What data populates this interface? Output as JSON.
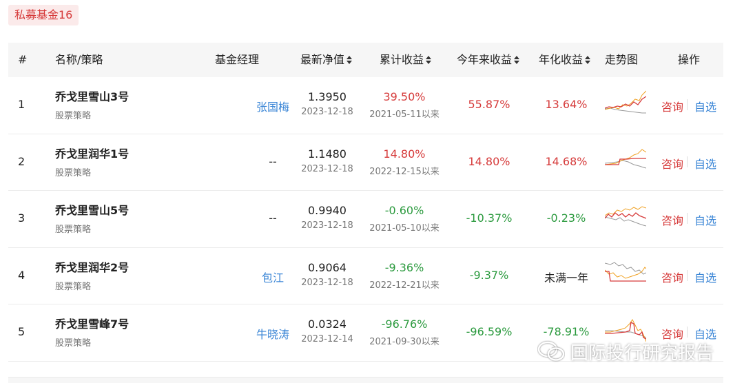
{
  "tag": "私募基金16",
  "headers": {
    "index": "#",
    "name": "名称/策略",
    "manager": "基金经理",
    "nav": "最新净值",
    "cumulative": "累计收益",
    "ytd": "今年来收益",
    "annual": "年化收益",
    "trend": "走势图",
    "ops": "操作"
  },
  "colors": {
    "red": "#d63b3b",
    "green": "#2b9a3e",
    "blue": "#3b86d6",
    "orange": "#f0a020",
    "gray": "#999999"
  },
  "rows": [
    {
      "index": "1",
      "name": "乔戈里雪山3号",
      "strategy": "股票策略",
      "manager": "张国梅",
      "nav": "1.3950",
      "nav_date": "2023-12-18",
      "cumulative": "39.50%",
      "since": "2021-05-11以来",
      "ytd": "55.87%",
      "annual": "13.64%",
      "consult": "咨询",
      "watch": "自选"
    },
    {
      "index": "2",
      "name": "乔戈里润华1号",
      "strategy": "股票策略",
      "manager": "--",
      "nav": "1.1480",
      "nav_date": "2023-12-18",
      "cumulative": "14.80%",
      "since": "2022-12-15以来",
      "ytd": "14.80%",
      "annual": "14.68%",
      "consult": "咨询",
      "watch": "自选"
    },
    {
      "index": "3",
      "name": "乔戈里雪山5号",
      "strategy": "股票策略",
      "manager": "--",
      "nav": "0.9940",
      "nav_date": "2023-12-18",
      "cumulative": "-0.60%",
      "since": "2021-05-10以来",
      "ytd": "-10.37%",
      "annual": "-0.23%",
      "consult": "咨询",
      "watch": "自选"
    },
    {
      "index": "4",
      "name": "乔戈里润华2号",
      "strategy": "股票策略",
      "manager": "包江",
      "nav": "0.9064",
      "nav_date": "2023-12-18",
      "cumulative": "-9.36%",
      "since": "2022-12-21以来",
      "ytd": "-9.37%",
      "annual": "未满一年",
      "consult": "咨询",
      "watch": "自选"
    },
    {
      "index": "5",
      "name": "乔戈里雪峰7号",
      "strategy": "股票策略",
      "manager": "牛晓涛",
      "nav": "0.0324",
      "nav_date": "2023-12-14",
      "cumulative": "-96.76%",
      "since": "2021-09-30以来",
      "ytd": "-96.59%",
      "annual": "-78.91%",
      "consult": "咨询",
      "watch": "自选"
    }
  ],
  "watermark": "国际投行研究报告"
}
